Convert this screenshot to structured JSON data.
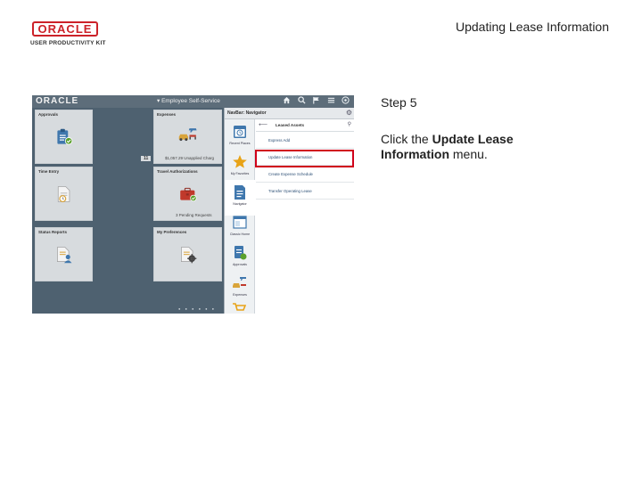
{
  "slide": {
    "brand_line1": "ORACLE",
    "brand_line2": "USER PRODUCTIVITY KIT",
    "title": "Updating Lease Information",
    "step": "Step 5",
    "instruction_prefix": "Click the ",
    "instruction_bold": "Update Lease Information",
    "instruction_suffix": " menu."
  },
  "app": {
    "logo": "ORACLE",
    "home_title": "▾ Employee Self-Service",
    "icons": [
      "home-icon",
      "search-icon",
      "flag-icon",
      "menu-icon",
      "navbar-icon"
    ],
    "tiles": [
      {
        "title": "Approvals",
        "icon": "clipboard-check-icon",
        "meta": "",
        "badge": ""
      },
      {
        "title": "Expenses",
        "icon": "travel-icon",
        "meta": "$1,057.29 Unapplied Charg",
        "badge": "11"
      },
      {
        "title": "Time Entry",
        "icon": "timesheet-icon",
        "meta": "",
        "badge": ""
      },
      {
        "title": "Travel Authorizations",
        "icon": "briefcase-check-icon",
        "meta": "3 Pending Requests",
        "badge": ""
      },
      {
        "title": "Status Reports",
        "icon": "person-report-icon",
        "meta": "",
        "badge": ""
      },
      {
        "title": "My Preferences",
        "icon": "settings-doc-icon",
        "meta": "",
        "badge": ""
      }
    ],
    "pager": "● ● ● ● ● ●"
  },
  "navbar": {
    "title": "NavBar: Navigator",
    "rail": [
      {
        "label": "Recent Places",
        "icon": "calendar-icon"
      },
      {
        "label": "My Favorites",
        "icon": "star-icon"
      },
      {
        "label": "Navigator",
        "icon": "document-icon"
      },
      {
        "label": "Classic Home",
        "icon": "window-icon"
      },
      {
        "label": "Approvals",
        "icon": "approvals-icon"
      },
      {
        "label": "Expenses",
        "icon": "expenses-icon"
      }
    ],
    "list_header": "Leased Assets",
    "items": [
      "Express Add",
      "Update Lease Information",
      "Create Expense Schedule",
      "Transfer Operating Lease"
    ]
  }
}
